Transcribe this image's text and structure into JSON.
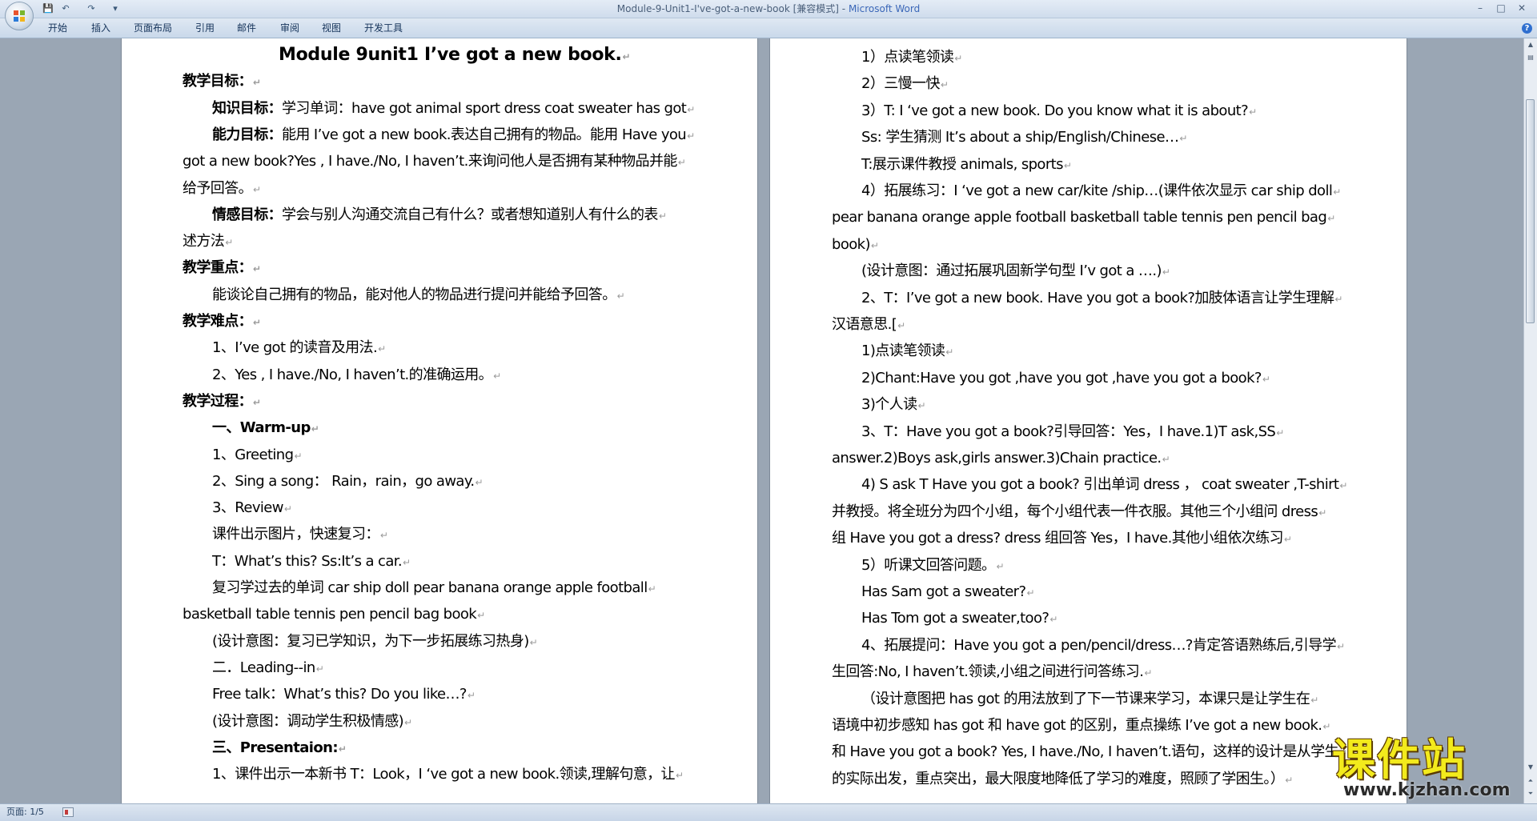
{
  "window": {
    "title": "Module-9-Unit1-I've-got-a-new-book [兼容模式] - ",
    "app_name": "Microsoft Word",
    "qat": [
      "💾",
      "↶",
      "↷",
      "▾"
    ]
  },
  "ribbon": {
    "tabs": [
      "开始",
      "插入",
      "页面布局",
      "引用",
      "邮件",
      "审阅",
      "视图",
      "开发工具"
    ]
  },
  "status": {
    "page": "页面: 1/5"
  },
  "watermark": {
    "text": "课件站",
    "url": "www.kjzhan.com"
  },
  "page1": {
    "lines": [
      {
        "t": "Module 9unit1 I’ve got a new book.",
        "s": "title"
      },
      {
        "t": "教学目标：",
        "s": "b"
      },
      {
        "t": "",
        "s": "",
        "k": "知识目标：",
        "r": "学习单词：have got animal sport dress coat sweater has got"
      },
      {
        "t": "",
        "s": "",
        "k": "能力目标：",
        "r": "能用 I’ve got a new book.表达自己拥有的物品。能用 Have you"
      },
      {
        "t": "got a new book?Yes , I have./No, I haven’t.来询问他人是否拥有某种物品并能",
        "s": ""
      },
      {
        "t": "给予回答。",
        "s": ""
      },
      {
        "t": "",
        "s": "",
        "k": "情感目标：",
        "r": "学会与别人沟通交流自己有什么？或者想知道别人有什么的表"
      },
      {
        "t": "述方法",
        "s": ""
      },
      {
        "t": "教学重点：",
        "s": "b"
      },
      {
        "t": "能谈论自己拥有的物品，能对他人的物品进行提问并能给予回答。",
        "s": ""
      },
      {
        "t": "教学难点：",
        "s": "b"
      },
      {
        "t": "1、I’ve got  的读音及用法.",
        "s": ""
      },
      {
        "t": "2、Yes , I have./No, I haven’t.的准确运用。",
        "s": ""
      },
      {
        "t": "教学过程：",
        "s": "b"
      },
      {
        "t": "一、Warm-up",
        "s": "b"
      },
      {
        "t": "1、Greeting",
        "s": ""
      },
      {
        "t": "2、Sing a song：  Rain，rain，go away.",
        "s": ""
      },
      {
        "t": "3、Review",
        "s": ""
      },
      {
        "t": "课件出示图片，快速复习：",
        "s": ""
      },
      {
        "t": "T：What’s this? Ss:It’s a car.",
        "s": ""
      },
      {
        "t": "复习学过去的单词 car ship doll pear banana orange apple football",
        "s": ""
      },
      {
        "t": "basketball table tennis pen pencil bag book",
        "s": ""
      },
      {
        "t": "(设计意图：复习已学知识，为下一步拓展练习热身)",
        "s": ""
      },
      {
        "t": "二．Leading--in",
        "s": ""
      },
      {
        "t": "Free talk：What’s this? Do you like…?",
        "s": ""
      },
      {
        "t": "(设计意图：调动学生积极情感)",
        "s": ""
      },
      {
        "t": "三、Presentaion:",
        "s": "b"
      },
      {
        "t": "1、课件出示一本新书 T：Look，I ‘ve got a new book.领读,理解句意，让",
        "s": ""
      }
    ]
  },
  "page2": {
    "lines": [
      {
        "t": "1）点读笔领读",
        "s": ""
      },
      {
        "t": "2）三慢一快",
        "s": ""
      },
      {
        "t": "3）T: I ‘ve got a new book. Do you know what it is about?",
        "s": ""
      },
      {
        "t": "Ss: 学生猜测 It’s about a ship/English/Chinese…",
        "s": ""
      },
      {
        "t": "T:展示课件教授 animals, sports",
        "s": ""
      },
      {
        "t": "4）拓展练习：I ‘ve got a new car/kite /ship…(课件依次显示 car ship doll",
        "s": ""
      },
      {
        "t": "pear banana orange apple football basketball table tennis pen pencil bag",
        "s": ""
      },
      {
        "t": "book)",
        "s": ""
      },
      {
        "t": "(设计意图：通过拓展巩固新学句型 I’v got a ….)",
        "s": ""
      },
      {
        "t": "2、T：I’ve got a new book. Have you got a book?加肢体语言让学生理解",
        "s": ""
      },
      {
        "t": "汉语意思.[",
        "s": ""
      },
      {
        "t": "1)点读笔领读",
        "s": ""
      },
      {
        "t": "2)Chant:Have you got ,have you got ,have you got a book?",
        "s": ""
      },
      {
        "t": "3)个人读",
        "s": ""
      },
      {
        "t": "3、T：Have you got a book?引导回答：Yes，I have.1)T ask,SS",
        "s": ""
      },
      {
        "t": "answer.2)Boys ask,girls answer.3)Chain practice.",
        "s": ""
      },
      {
        "t": "4) S ask T Have you got a book?  引出单词 dress ，  coat sweater ,T-shirt",
        "s": ""
      },
      {
        "t": "并教授。将全班分为四个小组，每个小组代表一件衣服。其他三个小组问 dress",
        "s": ""
      },
      {
        "t": "组 Have you got a dress? dress 组回答 Yes，I have.其他小组依次练习",
        "s": ""
      },
      {
        "t": "5）听课文回答问题。",
        "s": ""
      },
      {
        "t": "Has Sam got a sweater?",
        "s": ""
      },
      {
        "t": "Has Tom got a sweater,too?",
        "s": ""
      },
      {
        "t": "4、拓展提问：Have you got a pen/pencil/dress…?肯定答语熟练后,引导学",
        "s": ""
      },
      {
        "t": "生回答:No, I haven’t.领读,小组之间进行问答练习.",
        "s": ""
      },
      {
        "t": "（设计意图把 has got 的用法放到了下一节课来学习，本课只是让学生在",
        "s": ""
      },
      {
        "t": "语境中初步感知 has got 和 have got 的区别，重点操练 I’ve got a new book.",
        "s": ""
      },
      {
        "t": "和 Have you got a book? Yes, I have./No, I haven’t.语句，这样的设计是从学生",
        "s": ""
      },
      {
        "t": "的实际出发，重点突出，最大限度地降低了学习的难度，照顾了学困生。）",
        "s": ""
      }
    ]
  }
}
